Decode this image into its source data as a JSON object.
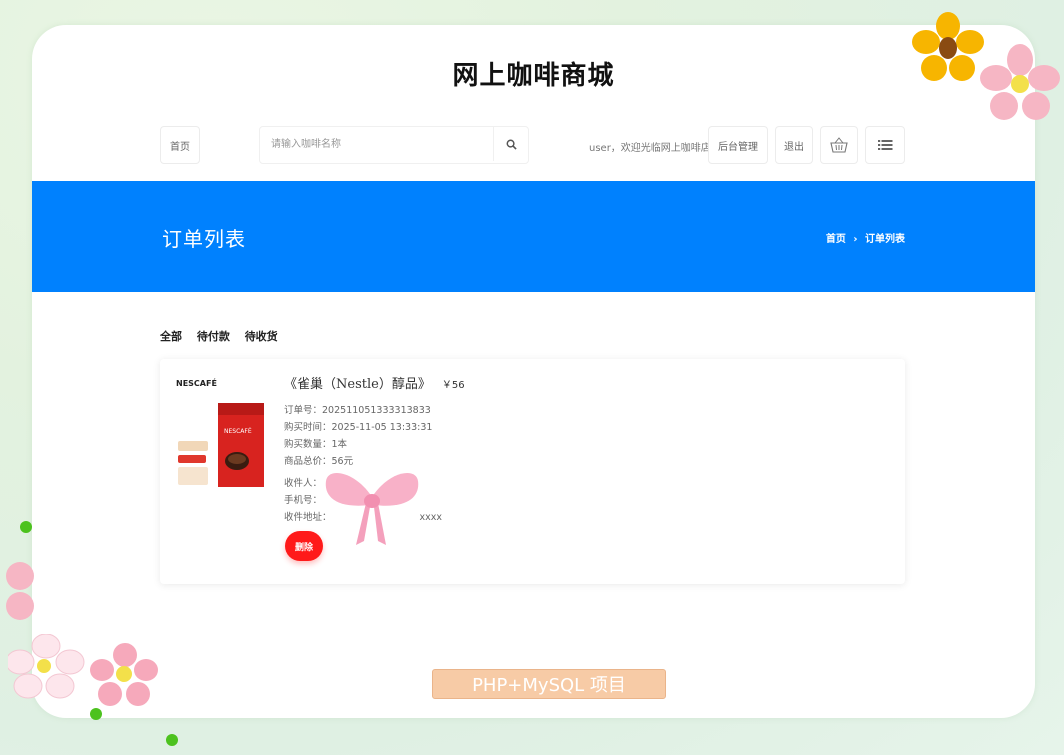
{
  "site": {
    "title": "网上咖啡商城"
  },
  "nav": {
    "home": "首页",
    "search_placeholder": "请输入咖啡名称",
    "welcome": "user，欢迎光临网上咖啡店",
    "admin": "后台管理",
    "logout": "退出",
    "cart_icon": "basket-icon",
    "menu_icon": "list-icon"
  },
  "banner": {
    "title": "订单列表",
    "breadcrumb_home": "首页",
    "breadcrumb_sep": "›",
    "breadcrumb_current": "订单列表"
  },
  "tabs": [
    "全部",
    "待付款",
    "待收货"
  ],
  "order": {
    "product_name": "《雀巢（Nestle）醇品》",
    "price": "￥56",
    "brand_logo": "NESCAFÉ",
    "package_text": "NESCAFÉ",
    "fields": [
      {
        "label": "订单号：",
        "value": "202511051333313833"
      },
      {
        "label": "购买时间：",
        "value": "2025-11-05 13:33:31"
      },
      {
        "label": "购买数量：",
        "value": "1本"
      },
      {
        "label": "商品总价：",
        "value": "56元"
      }
    ],
    "recipient": [
      {
        "label": "收件人：",
        "value": ""
      },
      {
        "label": "手机号：",
        "value": ""
      },
      {
        "label": "收件地址：",
        "value": "xxxx"
      }
    ],
    "delete": "删除"
  },
  "footer_badge": "PHP+MySQL 项目",
  "colors": {
    "banner": "#0081fe",
    "delete": "#ff1a1a",
    "badge": "#f7cba6"
  }
}
